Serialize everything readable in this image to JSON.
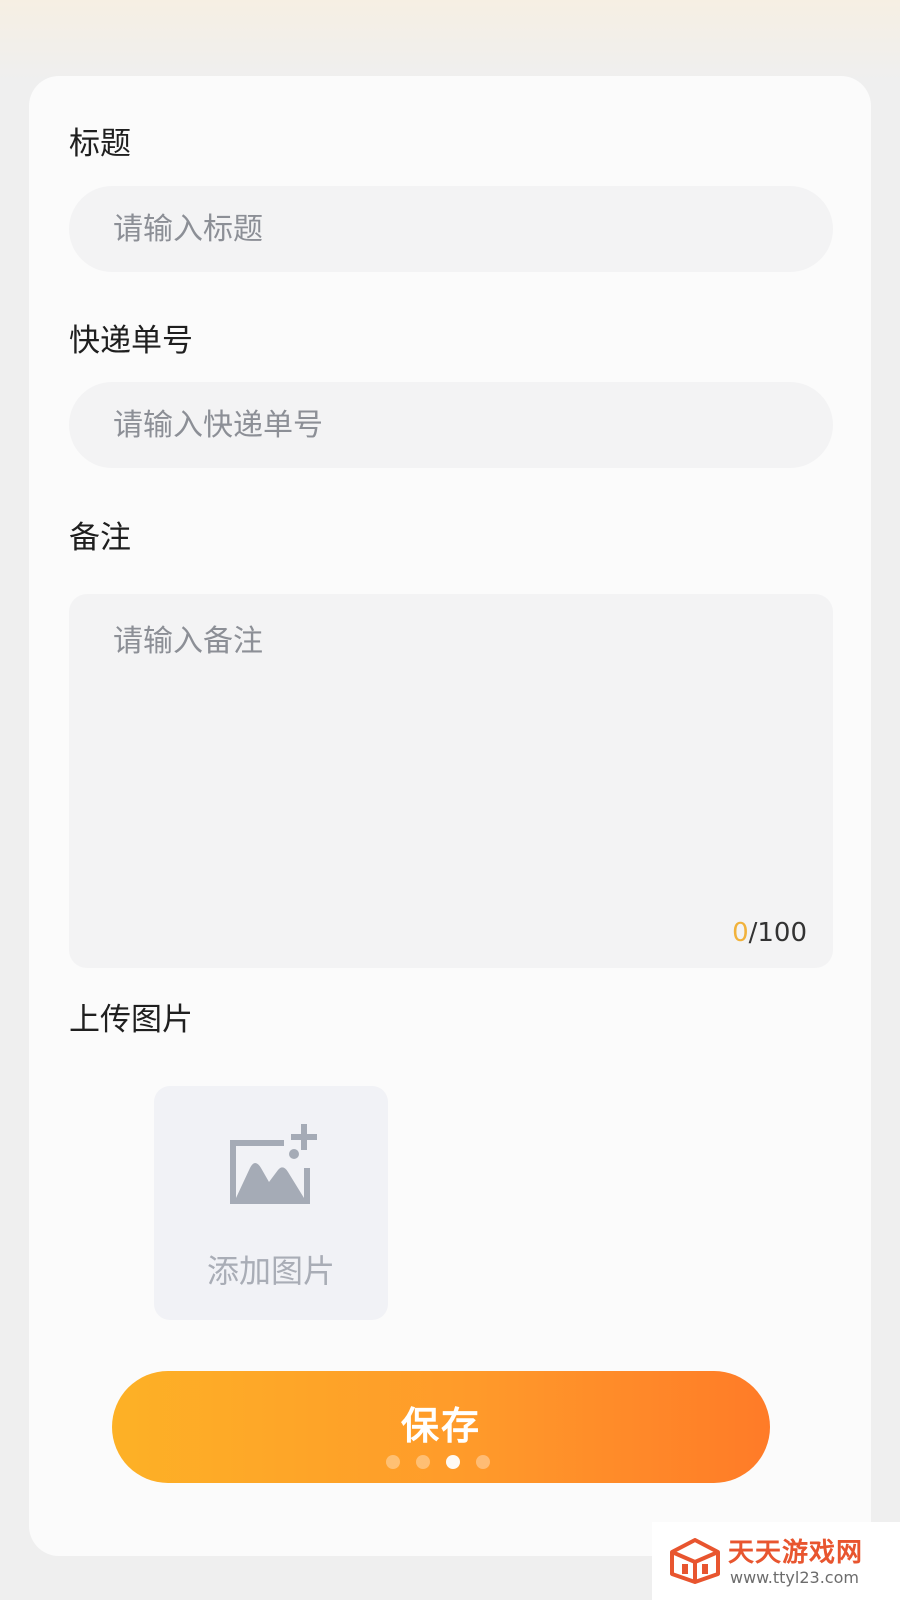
{
  "form": {
    "title_label": "标题",
    "title_placeholder": "请输入标题",
    "tracking_label": "快递单号",
    "tracking_placeholder": "请输入快递单号",
    "note_label": "备注",
    "note_placeholder": "请输入备注",
    "note_count_current": "0",
    "note_count_max": "/100",
    "upload_label": "上传图片",
    "upload_add_text": "添加图片",
    "save_label": "保存"
  },
  "pager": {
    "total": 4,
    "active_index": 2
  },
  "watermark": {
    "name": "天天游戏网",
    "url": "www.ttyl23.com"
  },
  "colors": {
    "accent_start": "#fdb126",
    "accent_end": "#ff7b28",
    "counter_highlight": "#f1b23b",
    "watermark": "#e8552f"
  },
  "icons": {
    "upload": "add-image-icon",
    "watermark_logo": "cube-logo-icon"
  }
}
